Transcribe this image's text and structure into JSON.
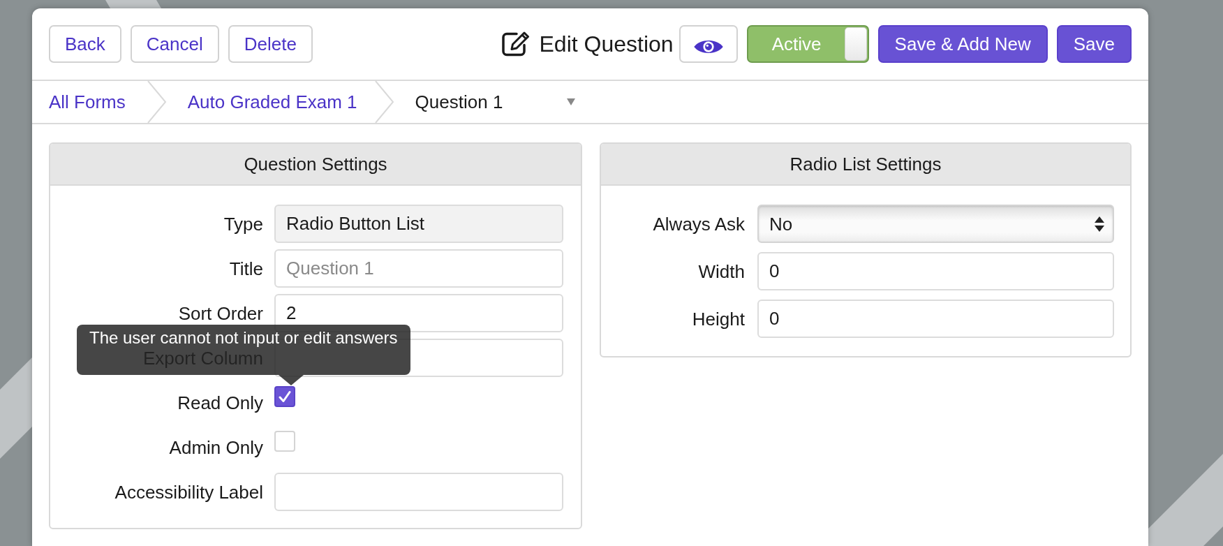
{
  "header": {
    "buttons": [
      {
        "label": "Back",
        "kind": "outline"
      },
      {
        "label": "Cancel",
        "kind": "outline"
      },
      {
        "label": "Delete",
        "kind": "outline"
      }
    ],
    "title": "Edit Question",
    "status_toggle": {
      "label": "Active",
      "on": true
    },
    "actions": [
      {
        "label": "Save & Add New",
        "kind": "primary"
      },
      {
        "label": "Save",
        "kind": "primary"
      }
    ]
  },
  "breadcrumb": [
    {
      "label": "All Forms",
      "selected": false,
      "dropdown": false
    },
    {
      "label": "Auto Graded Exam 1",
      "selected": false,
      "dropdown": false
    },
    {
      "label": "Question 1",
      "selected": true,
      "dropdown": true
    }
  ],
  "panels": [
    {
      "title": "Question Settings",
      "fields": [
        {
          "label": "Type",
          "kind": "text",
          "value": "Radio Button List",
          "disabled": true
        },
        {
          "label": "Title",
          "kind": "text",
          "placeholder": "Question 1",
          "disabled": false
        },
        {
          "label": "Sort Order",
          "kind": "text",
          "value": "2",
          "disabled": false
        },
        {
          "label": "Export Column",
          "kind": "text",
          "disabled": false
        },
        {
          "label": "Read Only",
          "kind": "checkbox",
          "checked": true,
          "tooltip": "The user cannot not input or edit answers"
        },
        {
          "label": "Admin Only",
          "kind": "checkbox",
          "checked": false
        },
        {
          "label": "Accessibility Label",
          "kind": "text",
          "disabled": false
        }
      ]
    },
    {
      "title": "Radio List Settings",
      "fields": [
        {
          "label": "Always Ask",
          "kind": "select",
          "value": "No"
        },
        {
          "label": "Width",
          "kind": "text",
          "value": "0",
          "disabled": false
        },
        {
          "label": "Height",
          "kind": "text",
          "value": "0",
          "disabled": false
        }
      ]
    }
  ]
}
